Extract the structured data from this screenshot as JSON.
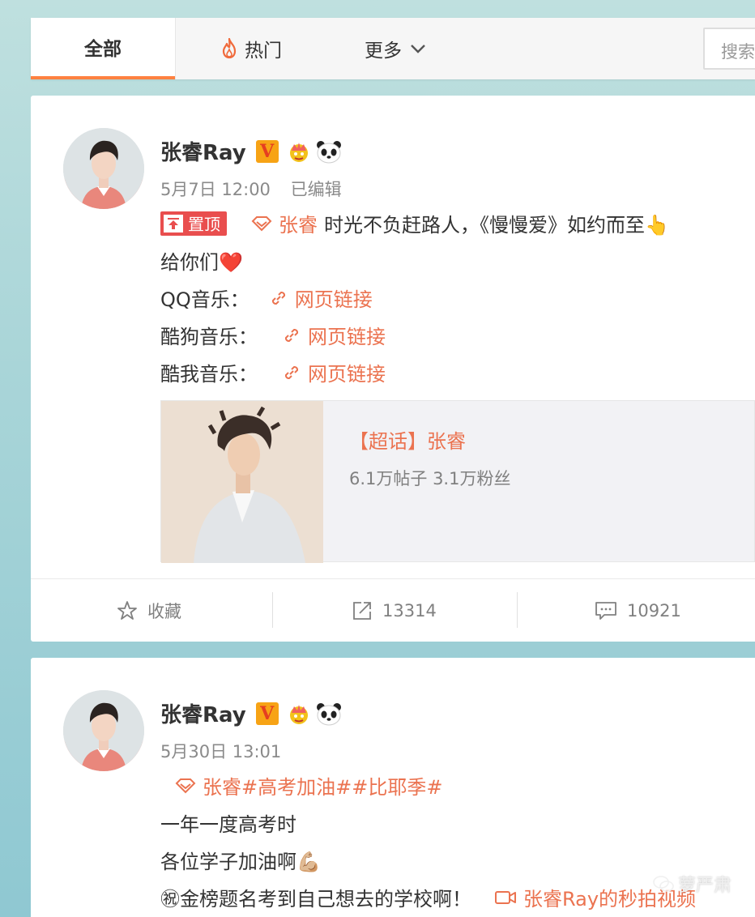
{
  "nav": {
    "tabs": [
      {
        "label": "全部",
        "active": true
      },
      {
        "label": "热门"
      },
      {
        "label": "更多"
      }
    ],
    "search_placeholder": "搜索"
  },
  "posts": [
    {
      "author": "张睿Ray",
      "verified": "V",
      "time": "5月7日 12:00",
      "edited": "已编辑",
      "pinned_label": "置顶",
      "topic_tag": "张睿",
      "text_line1": "时光不负赶路人，《慢慢爱》如约而至👆",
      "text_line2": "给你们❤️",
      "music_links": [
        {
          "label": "QQ音乐：",
          "link": "网页链接"
        },
        {
          "label": "酷狗音乐：",
          "link": "网页链接"
        },
        {
          "label": "酷我音乐：",
          "link": "网页链接"
        }
      ],
      "topic_card": {
        "title": "【超话】张睿",
        "stats": "6.1万帖子 3.1万粉丝"
      },
      "actions": {
        "favorite": "收藏",
        "repost": "13314",
        "comment": "10921"
      }
    },
    {
      "author": "张睿Ray",
      "verified": "V",
      "time": "5月30日 13:01",
      "topic_tag": "张睿#高考加油##比耶季#",
      "line1": "一年一度高考时",
      "line2": "各位学子加油啊💪🏼",
      "line3": "㊗金榜题名考到自己想去的学校啊！",
      "video_link": "张睿Ray的秒拍视频"
    }
  ],
  "watermark": "萝严肃"
}
